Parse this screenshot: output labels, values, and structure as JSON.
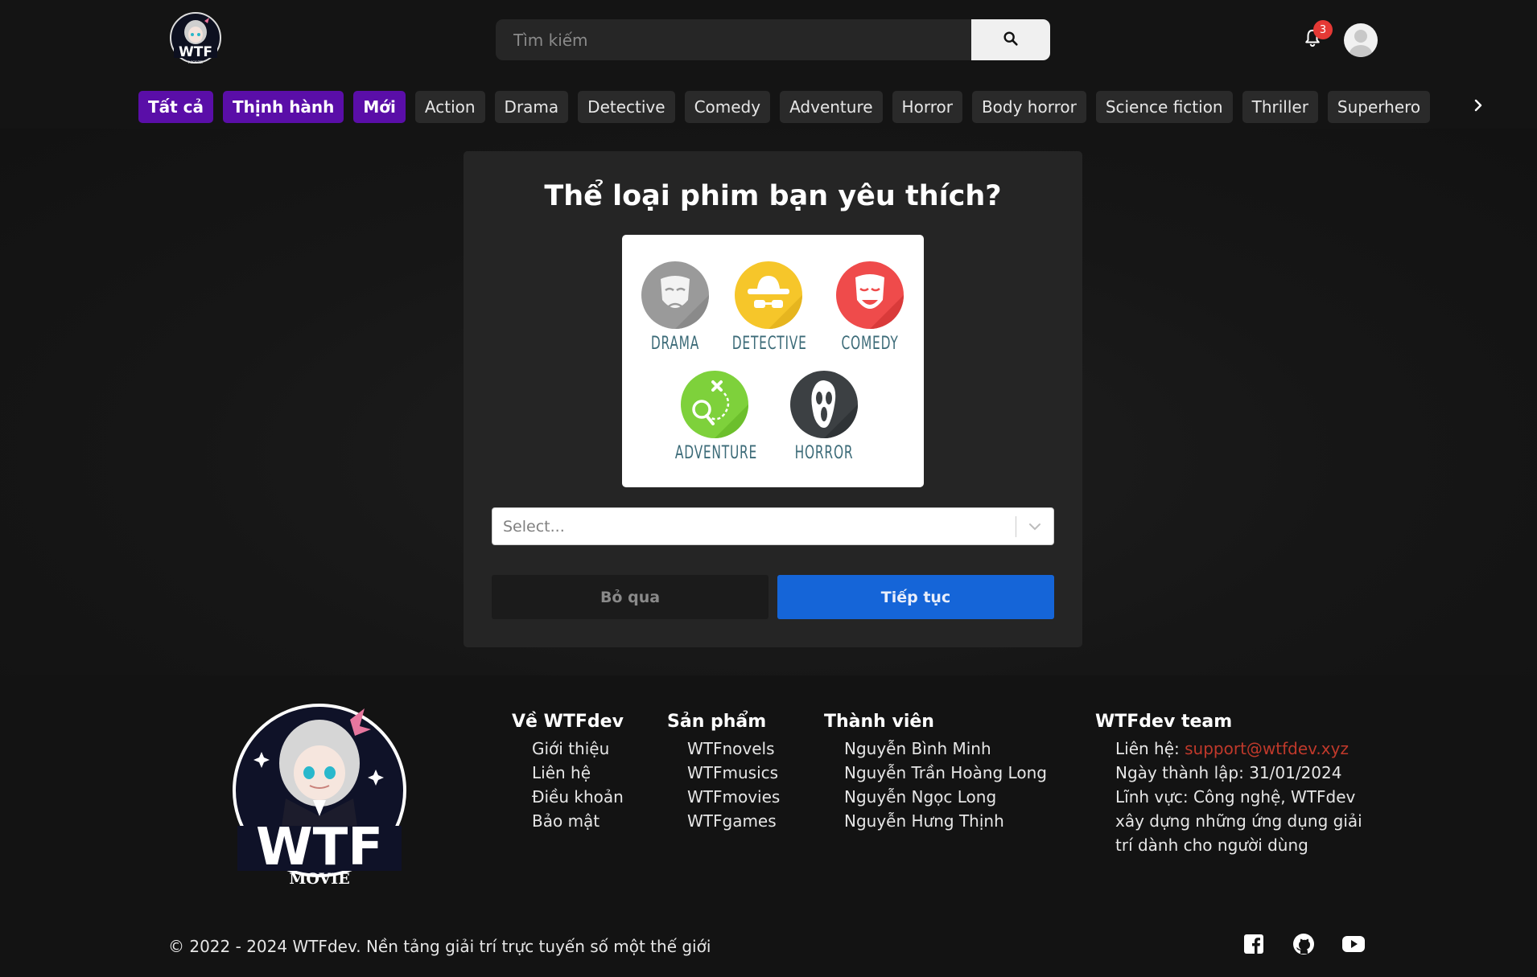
{
  "header": {
    "search_placeholder": "Tìm kiếm",
    "notification_count": "3",
    "logo_text": "WTF",
    "logo_sub": "MOVIE"
  },
  "genres": {
    "items": [
      {
        "label": "Tất cả",
        "special": true
      },
      {
        "label": "Thịnh hành",
        "special": true
      },
      {
        "label": "Mới",
        "special": true
      },
      {
        "label": "Action",
        "special": false
      },
      {
        "label": "Drama",
        "special": false
      },
      {
        "label": "Detective",
        "special": false
      },
      {
        "label": "Comedy",
        "special": false
      },
      {
        "label": "Adventure",
        "special": false
      },
      {
        "label": "Horror",
        "special": false
      },
      {
        "label": "Body horror",
        "special": false
      },
      {
        "label": "Science fiction",
        "special": false
      },
      {
        "label": "Thriller",
        "special": false
      },
      {
        "label": "Superhero",
        "special": false
      }
    ]
  },
  "dialog": {
    "title": "Thể loại phim bạn yêu thích?",
    "illustration": {
      "drama": "DRAMA",
      "detective": "DETECTIVE",
      "comedy": "COMEDY",
      "adventure": "ADVENTURE",
      "horror": "HORROR"
    },
    "select_placeholder": "Select...",
    "skip_label": "Bỏ qua",
    "continue_label": "Tiếp tục"
  },
  "footer": {
    "logo_text": "WTF",
    "logo_sub": "MOVIE",
    "about": {
      "heading": "Về WTFdev",
      "links": [
        "Giới thiệu",
        "Liên hệ",
        "Điều khoản",
        "Bảo mật"
      ]
    },
    "products": {
      "heading": "Sản phẩm",
      "links": [
        "WTFnovels",
        "WTFmusics",
        "WTFmovies",
        "WTFgames"
      ]
    },
    "members": {
      "heading": "Thành viên",
      "names": [
        "Nguyễn Bình Minh",
        "Nguyễn Trần Hoàng Long",
        "Nguyễn Ngọc Long",
        "Nguyễn Hưng Thịnh"
      ]
    },
    "team": {
      "heading": "WTFdev team",
      "contact_label": "Liên hệ: ",
      "contact_email": "support@wtfdev.xyz",
      "founded": "Ngày thành lập: 31/01/2024",
      "field_line1": "Lĩnh vực: Công nghệ, WTFdev",
      "field_line2": "xây dựng những ứng dụng giải",
      "field_line3": "trí dành cho người dùng"
    },
    "copyright": "© 2022 - 2024 WTFdev. Nền tảng giải trí trực tuyến số một thế giới"
  },
  "colors": {
    "accent_purple": "#5a0ea8",
    "primary_blue": "#1565d8",
    "badge_red": "#e53935",
    "link_red": "#c0392b"
  }
}
